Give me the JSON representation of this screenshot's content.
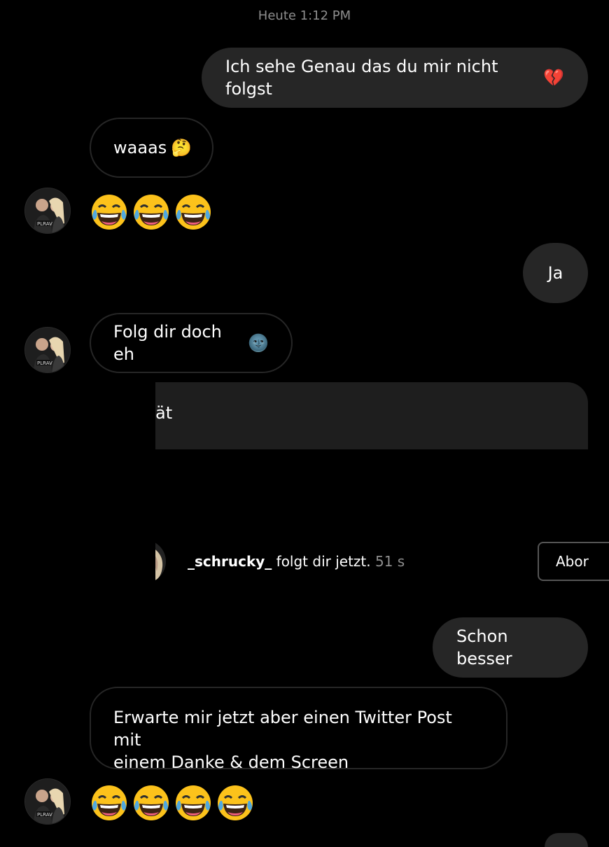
{
  "chat": {
    "timestamp": "Heute 1:12 PM",
    "messages": {
      "m1": "Ich sehe Genau das du mir nicht folgst",
      "m1_emoji": "💔",
      "m2": "waaas",
      "m2_emoji": "🤔",
      "m4": "Ja",
      "m5": "Folg dir doch eh",
      "m5_emoji": "🌚",
      "m6_partial": "ät",
      "m7": "Schon besser",
      "m8_line1": "Erwarte mir jetzt aber einen Twitter Post mit",
      "m8_line2": "einem Danke & dem Screen"
    },
    "laugh_emojis": [
      "😂",
      "😂",
      "😂",
      "😂"
    ]
  },
  "follow_notice": {
    "username": "_schrucky_",
    "text": "folgt dir jetzt.",
    "time": "51 s",
    "button_label": "Abor"
  },
  "colors": {
    "background": "#000000",
    "outgoing_bubble": "#262626",
    "incoming_border": "#262626",
    "muted_text": "#8e8e8e"
  }
}
